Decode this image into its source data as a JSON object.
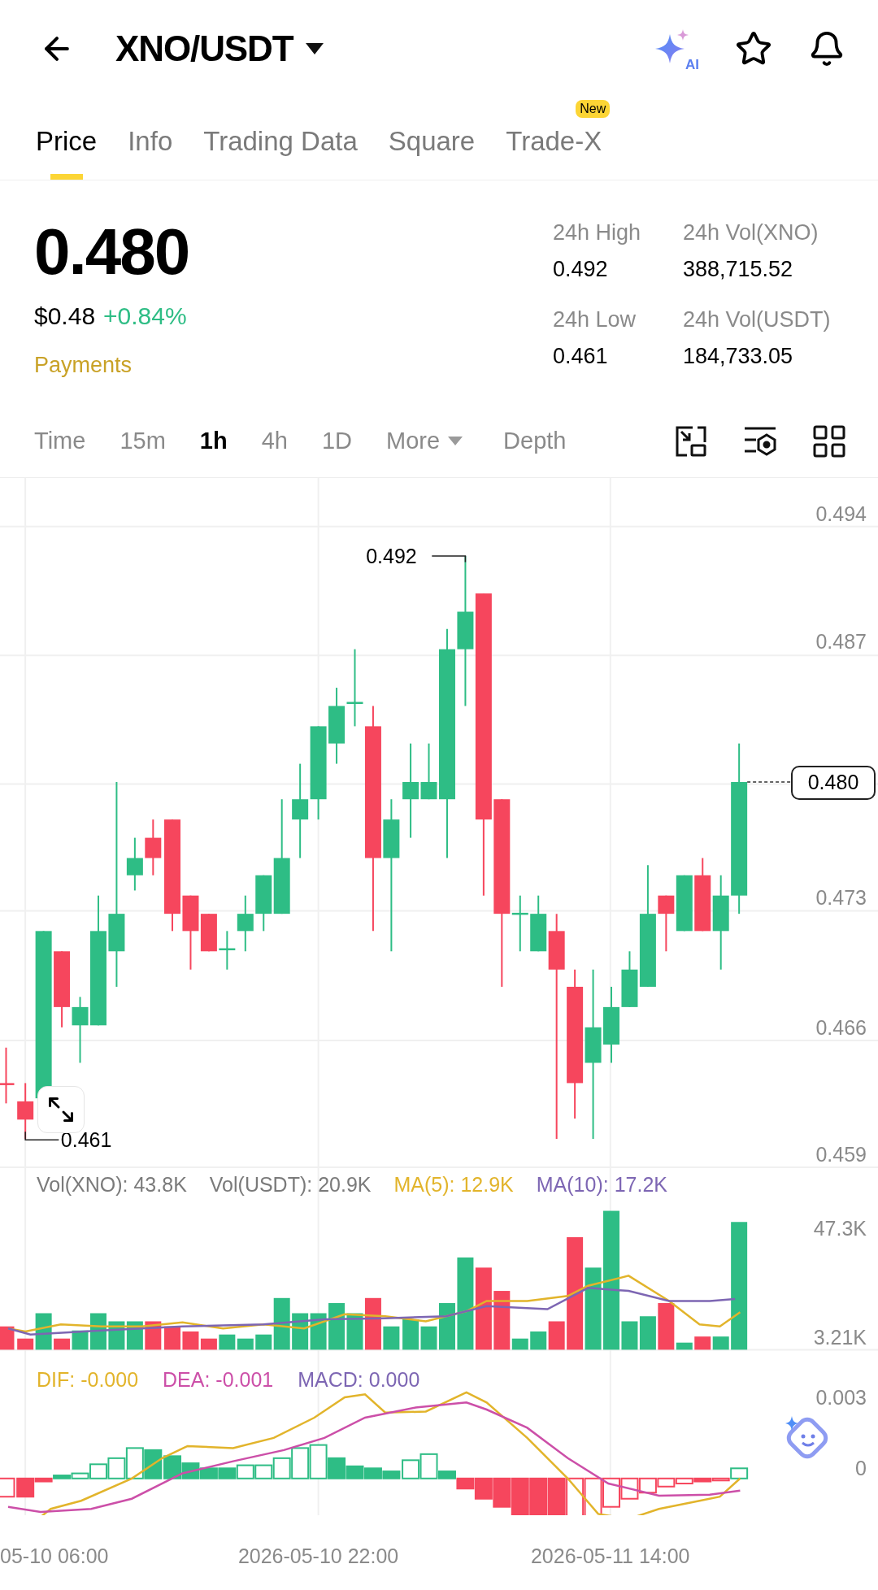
{
  "header": {
    "title": "XNO/USDT",
    "ai_label": "AI"
  },
  "tabs": [
    {
      "label": "Price",
      "selected": true
    },
    {
      "label": "Info",
      "selected": false
    },
    {
      "label": "Trading Data",
      "selected": false
    },
    {
      "label": "Square",
      "selected": false
    },
    {
      "label": "Trade-X",
      "selected": false,
      "badge": "New"
    }
  ],
  "price": {
    "last": "0.480",
    "usd": "$0.48",
    "change": "+0.84%",
    "tag": "Payments"
  },
  "stats": [
    {
      "label": "24h High",
      "value": "0.492"
    },
    {
      "label": "24h Vol(XNO)",
      "value": "388,715.52"
    },
    {
      "label": "24h Low",
      "value": "0.461"
    },
    {
      "label": "24h Vol(USDT)",
      "value": "184,733.05"
    }
  ],
  "intervals": [
    {
      "label": "Time",
      "selected": false
    },
    {
      "label": "15m",
      "selected": false
    },
    {
      "label": "1h",
      "selected": true
    },
    {
      "label": "4h",
      "selected": false
    },
    {
      "label": "1D",
      "selected": false
    }
  ],
  "more": "More",
  "depth": "Depth",
  "chart": {
    "price_axis": [
      "0.494",
      "0.487",
      "0.473",
      "0.466",
      "0.459"
    ],
    "current_price": "0.480",
    "high_marker": "0.492",
    "low_marker": "0.461",
    "volume_legend": [
      {
        "label": "Vol(XNO): 43.8K",
        "color": "#7a7a7a"
      },
      {
        "label": "Vol(USDT): 20.9K",
        "color": "#7a7a7a"
      },
      {
        "label": "MA(5): 12.9K",
        "color": "#e2b42b"
      },
      {
        "label": "MA(10): 17.2K",
        "color": "#7d66b3"
      }
    ],
    "volume_axis": [
      "47.3K",
      "3.21K"
    ],
    "macd_legend": [
      {
        "label": "DIF: -0.000",
        "color": "#e2b42b"
      },
      {
        "label": "DEA: -0.001",
        "color": "#cc4fa8"
      },
      {
        "label": "MACD: 0.000",
        "color": "#7d66b3"
      }
    ],
    "macd_axis": [
      "0.003",
      "0"
    ],
    "time_axis": [
      "05-10 06:00",
      "2026-05-10 22:00",
      "2026-05-11 14:00"
    ]
  }
}
